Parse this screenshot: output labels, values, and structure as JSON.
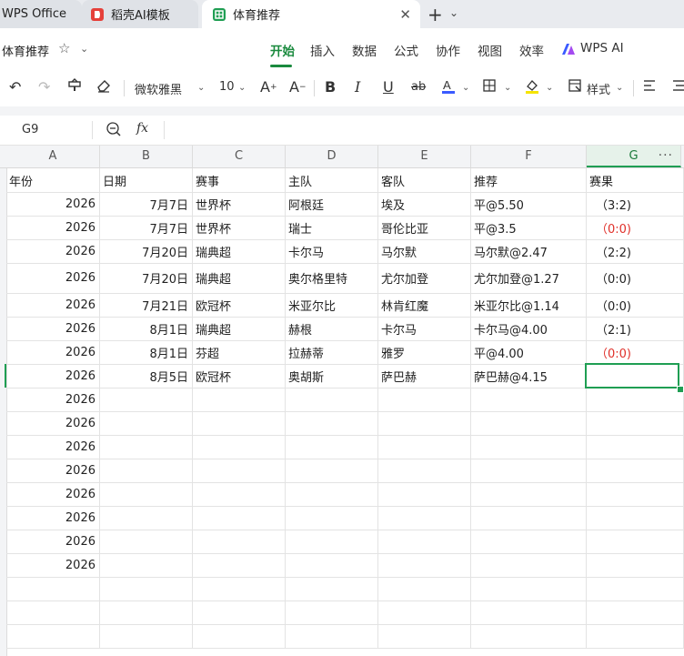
{
  "tabs": [
    {
      "label": "WPS Office"
    },
    {
      "label": "稻壳AI模板",
      "icon": "docer-icon"
    },
    {
      "label": "体育推荐",
      "icon": "spreadsheet-icon"
    }
  ],
  "doc_title": "体育推荐",
  "menu": [
    "开始",
    "插入",
    "数据",
    "公式",
    "协作",
    "视图",
    "效率"
  ],
  "active_menu": "开始",
  "ai_label": "WPS AI",
  "toolbar": {
    "font_name": "微软雅黑",
    "font_size": "10",
    "styles_label": "样式"
  },
  "formula_bar": {
    "name_box": "G9",
    "fx": "fx",
    "formula": ""
  },
  "columns": [
    "A",
    "B",
    "C",
    "D",
    "E",
    "F",
    "G"
  ],
  "selected_column": "G",
  "header_row": {
    "a": "年份",
    "b": "日期",
    "c": "赛事",
    "d": "主队",
    "e": "客队",
    "f": "推荐",
    "g": "赛果"
  },
  "rows": [
    {
      "a": "2026",
      "b": "7月7日",
      "c": "世界杯",
      "d": "阿根廷",
      "e": "埃及",
      "f": "平@5.50",
      "g": "（3:2)",
      "result_red": false
    },
    {
      "a": "2026",
      "b": "7月7日",
      "c": "世界杯",
      "d": "瑞士",
      "e": "哥伦比亚",
      "f": "平@3.5",
      "g": "（0:0)",
      "result_red": true
    },
    {
      "a": "2026",
      "b": "7月20日",
      "c": "瑞典超",
      "d": "卡尔马",
      "e": "马尔默",
      "f": "马尔默@2.47",
      "g": "（2:2)",
      "result_red": false
    },
    {
      "a": "2026",
      "b": "7月20日",
      "c": "瑞典超",
      "d": "奥尔格里特",
      "e": "尤尔加登",
      "f": "尤尔加登@1.27",
      "g": "（0:0)",
      "result_red": false
    },
    {
      "a": "2026",
      "b": "7月21日",
      "c": "欧冠杯",
      "d": "米亚尔比",
      "e": "林肯红魔",
      "f": "米亚尔比@1.14",
      "g": "（0:0)",
      "result_red": false
    },
    {
      "a": "2026",
      "b": "8月1日",
      "c": "瑞典超",
      "d": "赫根",
      "e": "卡尔马",
      "f": "卡尔马@4.00",
      "g": "（2:1)",
      "result_red": false
    },
    {
      "a": "2026",
      "b": "8月1日",
      "c": "芬超",
      "d": "拉赫蒂",
      "e": "雅罗",
      "f": "平@4.00",
      "g": "（0:0)",
      "result_red": true
    },
    {
      "a": "2026",
      "b": "8月5日",
      "c": "欧冠杯",
      "d": "奥胡斯",
      "e": "萨巴赫",
      "f": "萨巴赫@4.15",
      "g": "",
      "result_red": false
    },
    {
      "a": "2026"
    },
    {
      "a": "2026"
    },
    {
      "a": "2026"
    },
    {
      "a": "2026"
    },
    {
      "a": "2026"
    },
    {
      "a": "2026"
    },
    {
      "a": "2026"
    },
    {
      "a": "2026"
    },
    {
      "a": ""
    },
    {
      "a": ""
    },
    {
      "a": ""
    }
  ],
  "colors": {
    "accent": "#1a8a3e",
    "result_red": "#e0302a"
  }
}
